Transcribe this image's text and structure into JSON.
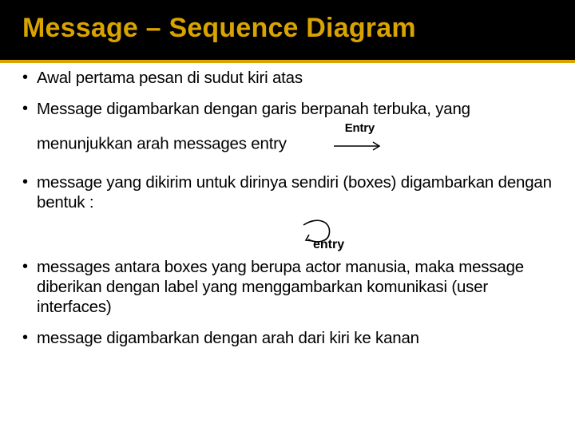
{
  "title": "Message – Sequence Diagram",
  "bullets": [
    "Awal pertama pesan di sudut kiri atas",
    "Message digambarkan dengan garis berpanah terbuka, yang menunjukkan arah messages entry",
    "message yang dikirim untuk dirinya sendiri (boxes) digambarkan dengan bentuk :",
    "messages antara boxes yang berupa actor manusia, maka message diberikan dengan label yang menggambarkan komunikasi (user interfaces)",
    "message digambarkan dengan arah dari kiri ke kanan"
  ],
  "figures": {
    "straight_label": "Entry",
    "self_label": "entry"
  }
}
